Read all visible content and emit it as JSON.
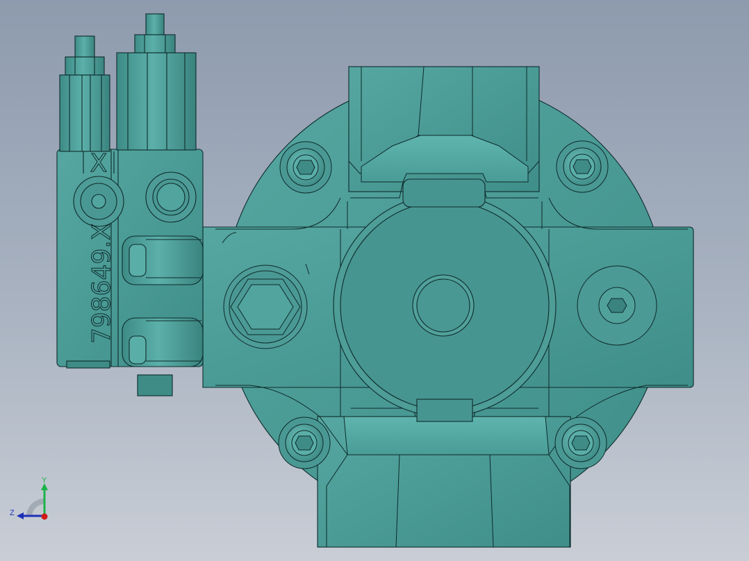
{
  "model": {
    "part_marking": "798649.X",
    "port_marking": "X",
    "colors": {
      "face": "#4f9d98",
      "face_light": "#5fb1ab",
      "face_dark": "#2e6d6a",
      "edge": "#0d2a2a",
      "background_top": "#8e9bae",
      "background_bottom": "#c9ced6"
    }
  },
  "triad": {
    "y_label": "Y",
    "z_label": "Z",
    "y_color": "#19b34a",
    "z_color": "#1d2fb8",
    "x_color": "#d11a1a"
  }
}
